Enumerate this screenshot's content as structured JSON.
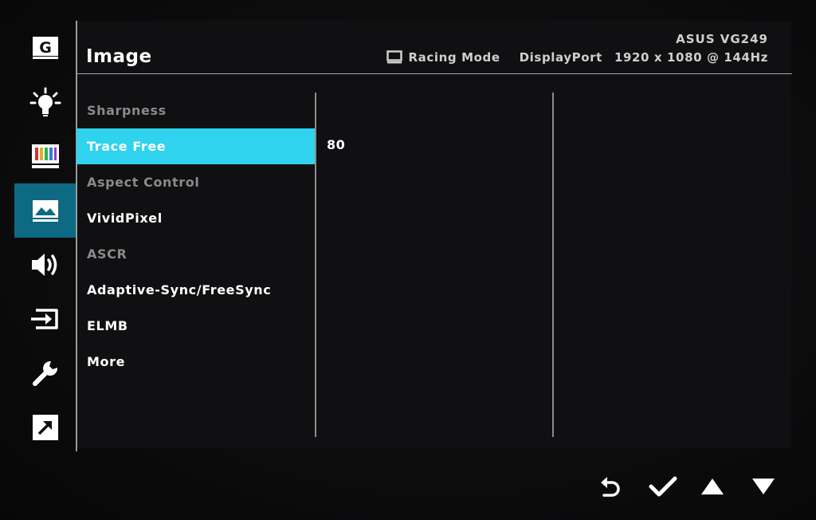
{
  "header": {
    "title": "Image",
    "model": "ASUS VG249",
    "mode": "Racing Mode",
    "input": "DisplayPort",
    "resolution": "1920 x 1080 @ 144Hz"
  },
  "sidebar": {
    "items": [
      {
        "icon": "gameplus-icon",
        "glyph": "G",
        "active": false
      },
      {
        "icon": "splendid-icon",
        "active": false
      },
      {
        "icon": "color-icon",
        "active": false
      },
      {
        "icon": "image-icon",
        "active": true
      },
      {
        "icon": "sound-icon",
        "active": false
      },
      {
        "icon": "input-select-icon",
        "active": false
      },
      {
        "icon": "system-setup-icon",
        "active": false
      },
      {
        "icon": "shortcut-icon",
        "active": false
      }
    ]
  },
  "menu": {
    "items": [
      {
        "label": "Sharpness",
        "state": "disabled"
      },
      {
        "label": "Trace Free",
        "state": "selected"
      },
      {
        "label": "Aspect Control",
        "state": "disabled"
      },
      {
        "label": "VividPixel",
        "state": "enabled"
      },
      {
        "label": "ASCR",
        "state": "disabled"
      },
      {
        "label": "Adaptive-Sync/FreeSync",
        "state": "enabled"
      },
      {
        "label": "ELMB",
        "state": "enabled"
      },
      {
        "label": "More",
        "state": "enabled"
      }
    ]
  },
  "submenu": {
    "value": "80"
  },
  "nav": [
    "back-icon",
    "confirm-icon",
    "up-icon",
    "down-icon"
  ],
  "colors": {
    "accent": "#2fd3ee",
    "sidebar_active": "#0d6a82",
    "disabled_text": "#8a8a8a"
  }
}
